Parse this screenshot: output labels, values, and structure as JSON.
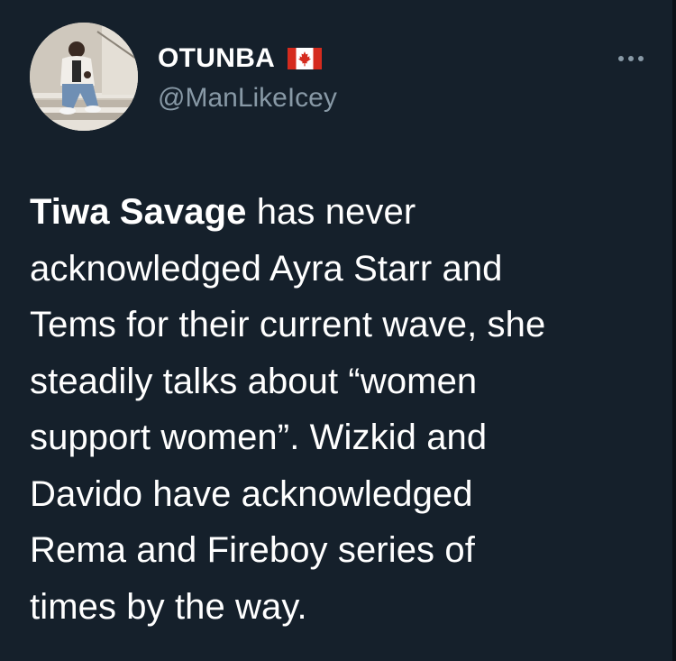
{
  "tweet": {
    "author": {
      "display_name": "OTUNBA",
      "flag_icon": "canada-flag-icon",
      "handle": "@ManLikeIcey"
    },
    "more_icon": "ellipsis-icon",
    "text_bold": "Tiwa Savage",
    "text_rest": " has never\nacknowledged Ayra Starr and\nTems for their current wave, she\nsteadily talks about “women\nsupport women”. Wizkid and\nDavido have acknowledged\nRema and Fireboy series of\ntimes by the way."
  },
  "colors": {
    "background": "#15202b",
    "text_primary": "#ffffff",
    "text_secondary": "#8899a6",
    "flag_red": "#d52b1e"
  }
}
